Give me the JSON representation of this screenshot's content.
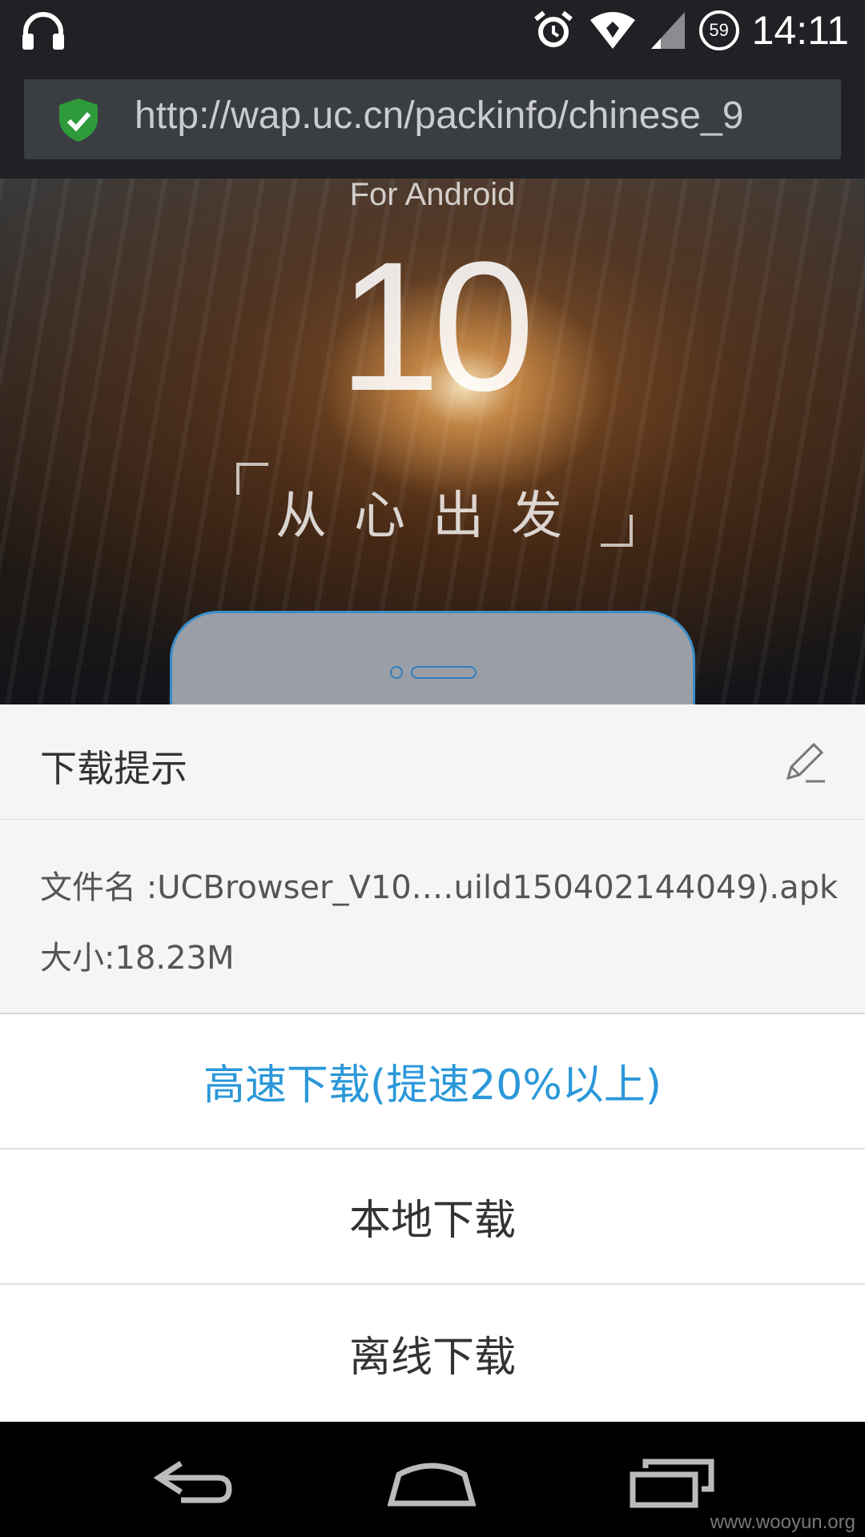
{
  "status_bar": {
    "time": "14:11",
    "battery_level": "59",
    "icons": [
      "headphones-icon",
      "alarm-icon",
      "wifi-icon",
      "signal-icon",
      "battery-icon"
    ]
  },
  "browser": {
    "url": "http://wap.uc.cn/packinfo/chinese_9"
  },
  "hero": {
    "platform": "For Android",
    "version": "10",
    "tagline": "从心出发"
  },
  "dialog": {
    "title": "下载提示",
    "file_name": "文件名 :UCBrowser_V10.…uild150402144049).apk",
    "file_size": "大小:18.23M",
    "options": {
      "fast": "高速下载(提速20%以上)",
      "local": "本地下载",
      "offline": "离线下载"
    }
  },
  "colors": {
    "accent": "#2b98d9",
    "shield": "#2e9a3a"
  },
  "watermark": "www.wooyun.org"
}
